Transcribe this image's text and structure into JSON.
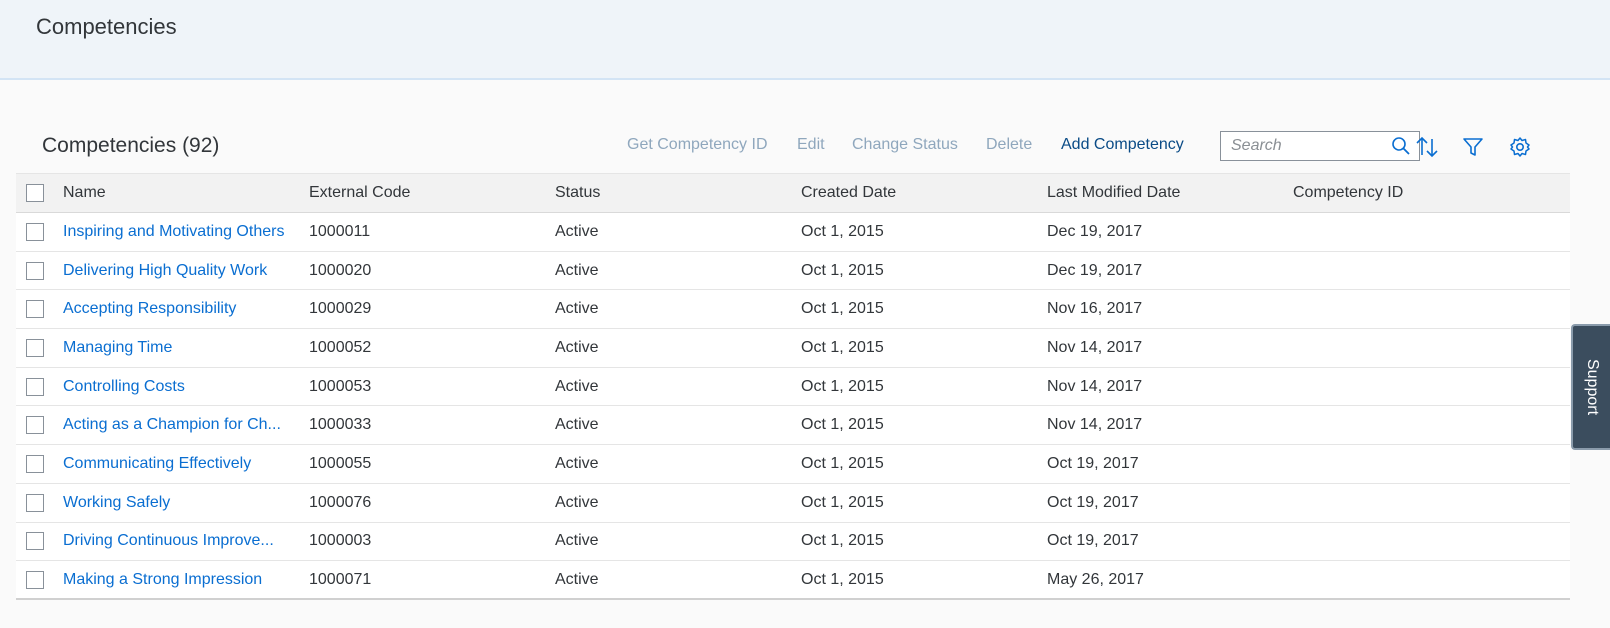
{
  "header": {
    "title": "Competencies"
  },
  "toolbar": {
    "table_title": "Competencies (92)",
    "buttons": {
      "get_id": "Get Competency ID",
      "edit": "Edit",
      "change_status": "Change Status",
      "delete": "Delete",
      "add": "Add Competency"
    },
    "search": {
      "placeholder": "Search",
      "value": ""
    },
    "icons": [
      "search-icon",
      "sort-icon",
      "filter-icon",
      "settings-gear-icon"
    ]
  },
  "table": {
    "columns": [
      "Name",
      "External Code",
      "Status",
      "Created Date",
      "Last Modified Date",
      "Competency ID"
    ],
    "rows": [
      [
        "Inspiring and Motivating Others",
        "1000011",
        "Active",
        "Oct 1, 2015",
        "Dec 19, 2017",
        ""
      ],
      [
        "Delivering High Quality Work",
        "1000020",
        "Active",
        "Oct 1, 2015",
        "Dec 19, 2017",
        ""
      ],
      [
        "Accepting Responsibility",
        "1000029",
        "Active",
        "Oct 1, 2015",
        "Nov 16, 2017",
        ""
      ],
      [
        "Managing Time",
        "1000052",
        "Active",
        "Oct 1, 2015",
        "Nov 14, 2017",
        ""
      ],
      [
        "Controlling Costs",
        "1000053",
        "Active",
        "Oct 1, 2015",
        "Nov 14, 2017",
        ""
      ],
      [
        "Acting as a Champion for Ch...",
        "1000033",
        "Active",
        "Oct 1, 2015",
        "Nov 14, 2017",
        ""
      ],
      [
        "Communicating Effectively",
        "1000055",
        "Active",
        "Oct 1, 2015",
        "Oct 19, 2017",
        ""
      ],
      [
        "Working Safely",
        "1000076",
        "Active",
        "Oct 1, 2015",
        "Oct 19, 2017",
        ""
      ],
      [
        "Driving Continuous Improve...",
        "1000003",
        "Active",
        "Oct 1, 2015",
        "Oct 19, 2017",
        ""
      ],
      [
        "Making a Strong Impression",
        "1000071",
        "Active",
        "Oct 1, 2015",
        "May 26, 2017",
        ""
      ]
    ]
  },
  "support": {
    "label": "Support"
  },
  "colors": {
    "link": "#0a6ed1",
    "header_bg": "#eff4f9",
    "disabled_action": "#8fa7bd",
    "enabled_action": "#0a4b86"
  }
}
